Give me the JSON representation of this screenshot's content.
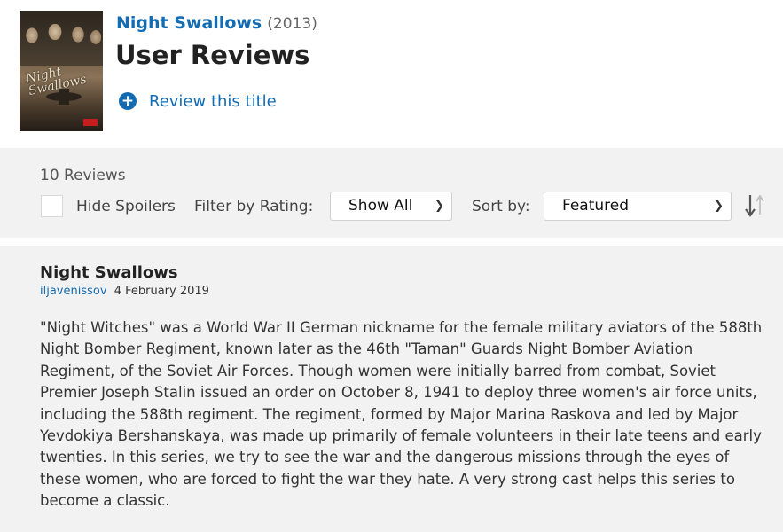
{
  "header": {
    "title": "Night Swallows",
    "year": "(2013)",
    "heading": "User Reviews",
    "review_cta": "Review this title",
    "poster_title": "Night Swallows"
  },
  "filters": {
    "review_count": "10 Reviews",
    "hide_spoilers": "Hide Spoilers",
    "filter_label": "Filter by Rating:",
    "rating_value": "Show All",
    "sort_label": "Sort by:",
    "sort_value": "Featured"
  },
  "review": {
    "title": "Night Swallows",
    "author": "iljavenissov",
    "date": "4 February 2019",
    "body": "\"Night Witches\" was a World War II German nickname for the female military aviators of the 588th Night Bomber Regiment, known later as the 46th \"Taman\" Guards Night Bomber Aviation Regiment, of the Soviet Air Forces. Though women were initially barred from combat, Soviet Premier Joseph Stalin issued an order on October 8, 1941 to deploy three women's air force units, including the 588th regiment. The regiment, formed by Major Marina Raskova and led by Major Yevdokiya Bershanskaya, was made up primarily of female volunteers in their late teens and early twenties. In this series, we try to see the war and the dangerous missions through the eyes of these women, who are forced to fight the war they hate. A very strong cast helps this series to become a classic."
  },
  "icons": {
    "add": "plus-circle-icon",
    "dropdown": "chevron-down-icon",
    "sort": "sort-direction-icon"
  },
  "colors": {
    "link": "#136cb2",
    "panel_background": "#f2f2f2"
  }
}
